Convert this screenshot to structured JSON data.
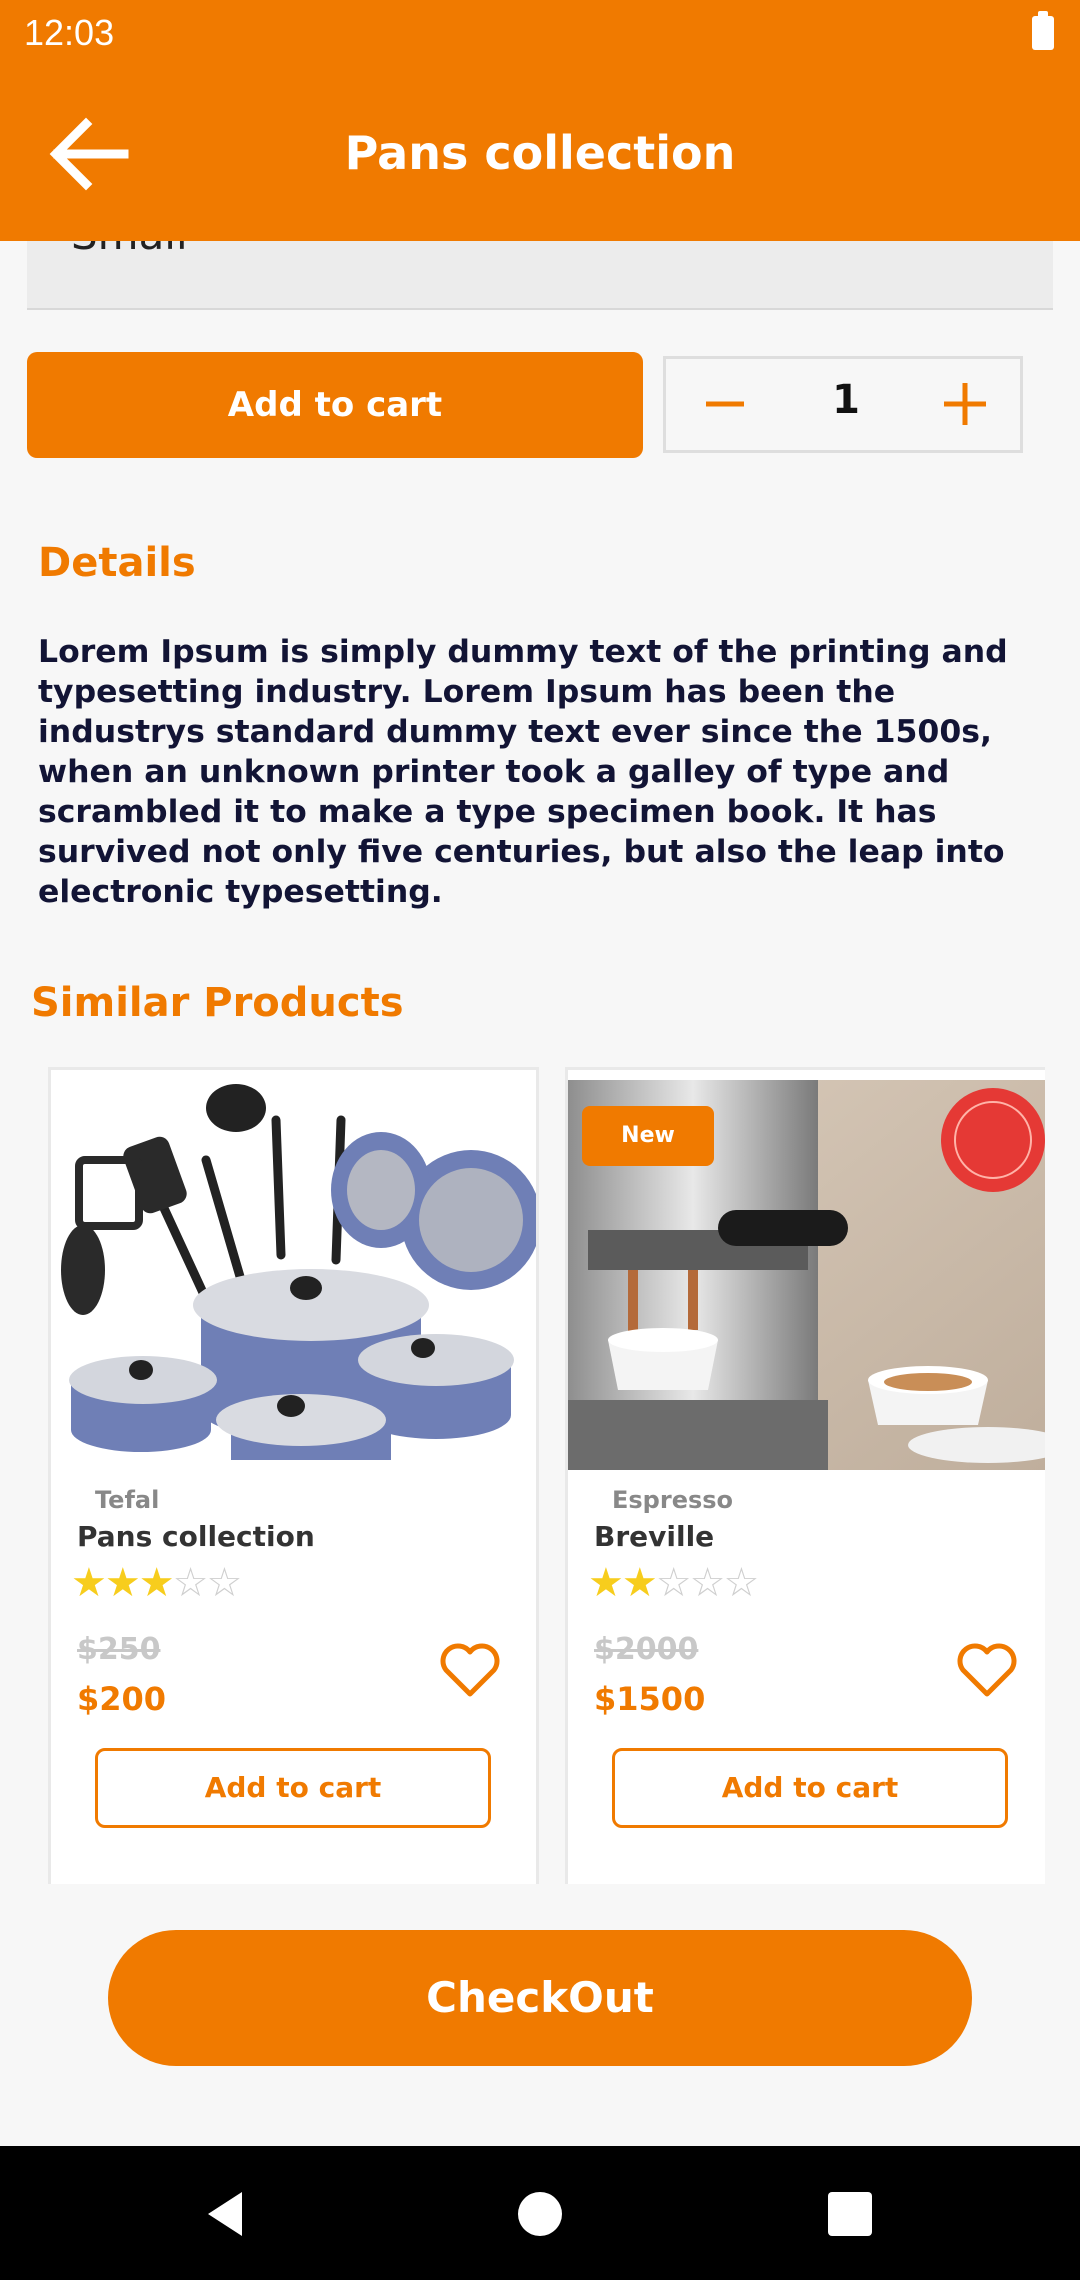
{
  "status_bar": {
    "time": "12:03"
  },
  "app_bar": {
    "title": "Pans collection"
  },
  "size_select": {
    "value": "Small"
  },
  "actions": {
    "add_to_cart": "Add to cart",
    "quantity": "1"
  },
  "details": {
    "title": "Details",
    "text": "Lorem Ipsum is simply dummy text of the printing and typesetting industry. Lorem Ipsum has been the industrys standard dummy text ever since the 1500s, when an unknown printer took a galley of type and scrambled it to make a type specimen book. It has survived not only five centuries, but also the leap into electronic typesetting."
  },
  "similar": {
    "title": "Similar Products",
    "products": [
      {
        "brand": "Tefal",
        "name": "Pans collection",
        "rating": 3,
        "rating_max": 5,
        "old_price": "$250",
        "price": "$200",
        "button": "Add to cart"
      },
      {
        "badge": "New",
        "brand": "Espresso",
        "name": "Breville",
        "rating": 2,
        "rating_max": 5,
        "old_price": "$2000",
        "price": "$1500",
        "button": "Add to cart"
      }
    ]
  },
  "checkout": {
    "label": "CheckOut"
  },
  "colors": {
    "accent": "#f07a00",
    "star": "#f7cd1d",
    "text_dark": "#121435"
  }
}
